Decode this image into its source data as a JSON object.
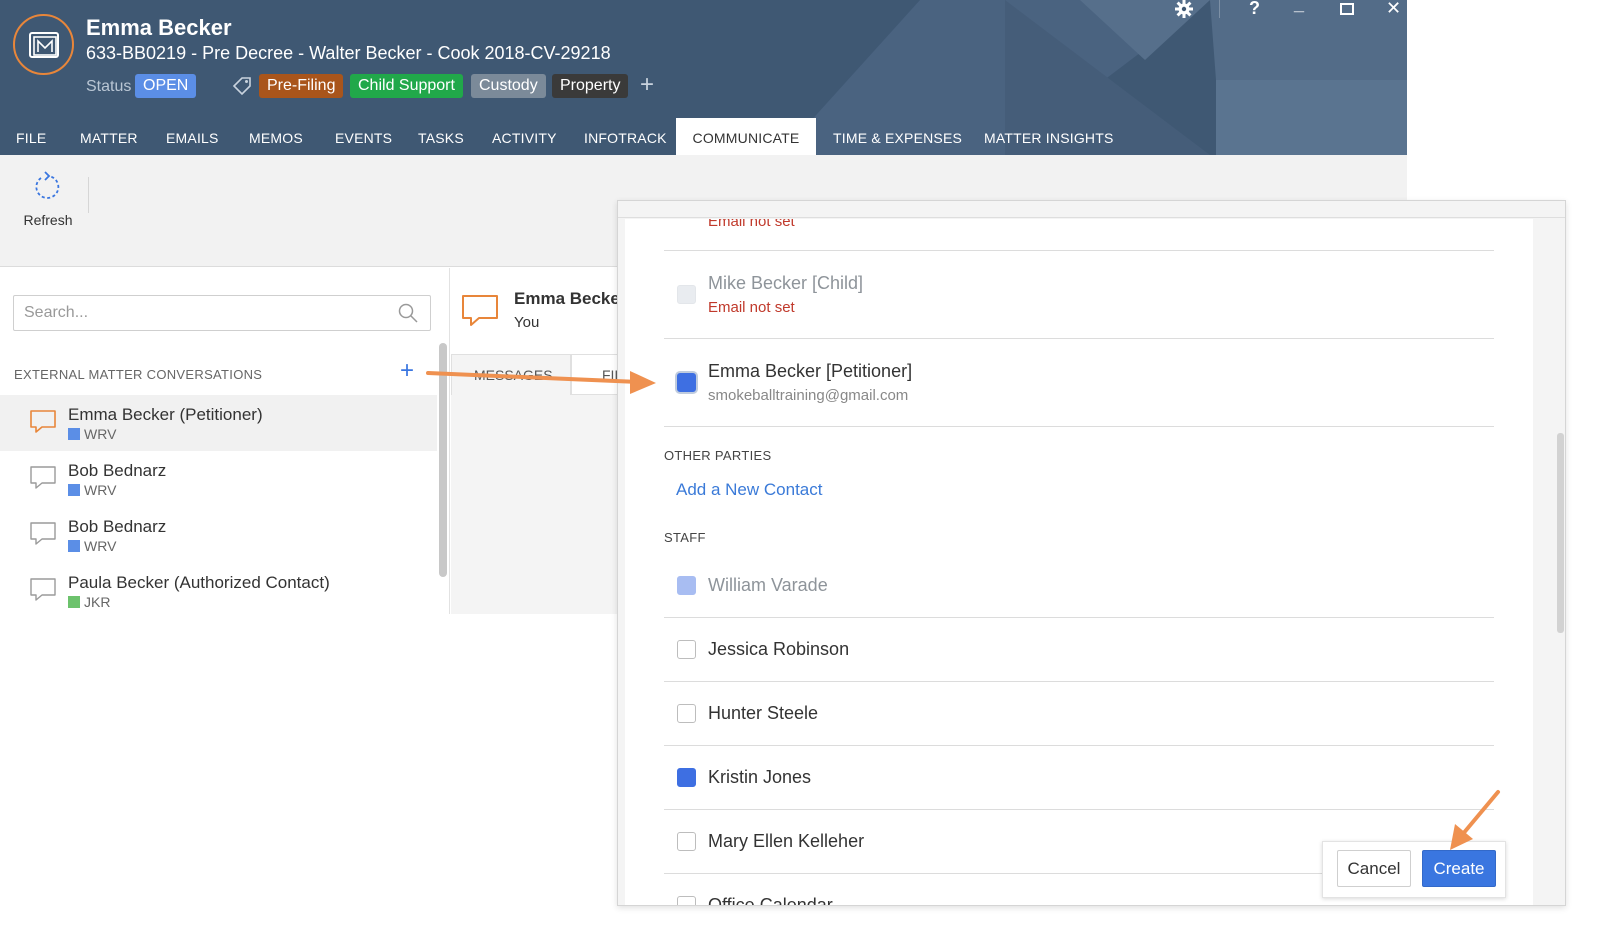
{
  "matter": {
    "client_name": "Emma Becker",
    "description": "633-BB0219 - Pre Decree - Walter Becker - Cook 2018-CV-29218",
    "status_label": "Status",
    "status_value": "OPEN",
    "tags": [
      {
        "label": "Pre-Filing",
        "color": "#a9551b"
      },
      {
        "label": "Child Support",
        "color": "#21a84a"
      },
      {
        "label": "Custody",
        "color": "#7b8a99"
      },
      {
        "label": "Property",
        "color": "#3a3a3a"
      }
    ]
  },
  "window_controls": {
    "help": "?",
    "minimize": "_",
    "close": "✕"
  },
  "nav_tabs": [
    "FILE",
    "MATTER",
    "EMAILS",
    "MEMOS",
    "EVENTS",
    "TASKS",
    "ACTIVITY",
    "INFOTRACK",
    "COMMUNICATE",
    "TIME & EXPENSES",
    "MATTER INSIGHTS"
  ],
  "active_tab": "COMMUNICATE",
  "toolbar": {
    "refresh_label": "Refresh"
  },
  "left_panel": {
    "search_placeholder": "Search...",
    "section_title": "EXTERNAL MATTER CONVERSATIONS",
    "add_symbol": "+",
    "conversations": [
      {
        "name": "Emma Becker (Petitioner)",
        "tag": "WRV",
        "tag_color": "#5b8ee6",
        "selected": true
      },
      {
        "name": "Bob Bednarz",
        "tag": "WRV",
        "tag_color": "#5b8ee6",
        "selected": false
      },
      {
        "name": "Bob Bednarz",
        "tag": "WRV",
        "tag_color": "#5b8ee6",
        "selected": false
      },
      {
        "name": "Paula Becker (Authorized Contact)",
        "tag": "JKR",
        "tag_color": "#6cc26c",
        "selected": false
      }
    ]
  },
  "middle_panel": {
    "title": "Emma Becker",
    "subtitle": "You",
    "tab_messages": "MESSAGES",
    "tab_files": "FILES"
  },
  "dialog": {
    "top_partial_error": "Email not set",
    "participants": [
      {
        "name": "Mike Becker [Child]",
        "detail": "Email not set",
        "detail_error": true,
        "state": "disabled"
      },
      {
        "name": "Emma Becker [Petitioner]",
        "detail": "smokeballtraining@gmail.com",
        "detail_error": false,
        "state": "checked"
      }
    ],
    "other_parties_title": "OTHER PARTIES",
    "add_contact_link": "Add a New Contact",
    "staff_title": "STAFF",
    "staff": [
      {
        "name": "William Varade",
        "state": "checked-disabled"
      },
      {
        "name": "Jessica Robinson",
        "state": "unchecked"
      },
      {
        "name": "Hunter Steele",
        "state": "unchecked"
      },
      {
        "name": "Kristin Jones",
        "state": "checked"
      },
      {
        "name": "Mary Ellen Kelleher",
        "state": "unchecked"
      },
      {
        "name": "Office Calendar",
        "state": "unchecked"
      }
    ],
    "cancel_label": "Cancel",
    "create_label": "Create"
  },
  "colors": {
    "header_bg": "#3f5873",
    "accent_orange": "#e8863a",
    "primary_blue": "#3a76e0",
    "status_blue": "#5b8ee6"
  }
}
